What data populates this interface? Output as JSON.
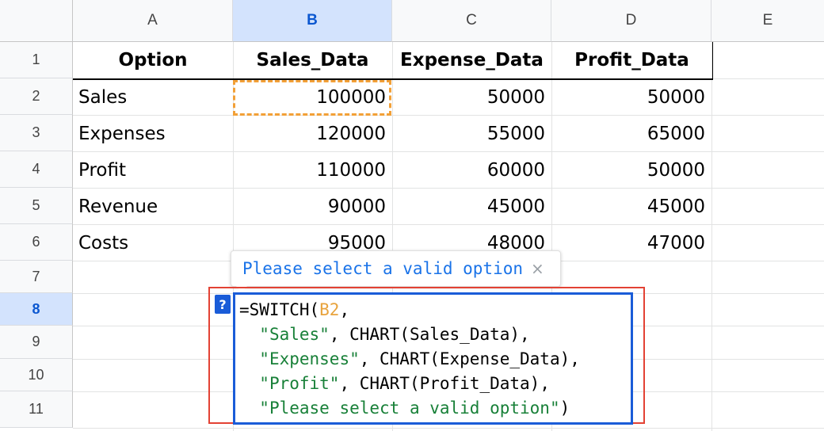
{
  "columns": [
    "A",
    "B",
    "C",
    "D",
    "E"
  ],
  "selected_column": "B",
  "rows": [
    "1",
    "2",
    "3",
    "4",
    "5",
    "6",
    "7",
    "8",
    "9",
    "10",
    "11"
  ],
  "selected_row": "8",
  "table": {
    "headers": [
      "Option",
      "Sales_Data",
      "Expense_Data",
      "Profit_Data"
    ],
    "data": [
      [
        "Sales",
        "100000",
        "50000",
        "50000"
      ],
      [
        "Expenses",
        "120000",
        "55000",
        "65000"
      ],
      [
        "Profit",
        "110000",
        "60000",
        "50000"
      ],
      [
        "Revenue",
        "90000",
        "45000",
        "45000"
      ],
      [
        "Costs",
        "95000",
        "48000",
        "47000"
      ]
    ]
  },
  "tooltip": {
    "text": "Please select a valid option",
    "close_glyph": "×"
  },
  "formula_help_glyph": "?",
  "formula": {
    "l1_prefix": "=SWITCH(",
    "l1_ref": "B2",
    "l1_suffix": ",",
    "l2_str": "\"Sales\"",
    "l2_rest": ", CHART(Sales_Data),",
    "l3_str": "\"Expenses\"",
    "l3_rest": ", CHART(Expense_Data),",
    "l4_str": "\"Profit\"",
    "l4_rest": ", CHART(Profit_Data),",
    "l5_str": "\"Please select a valid option\"",
    "l5_rest": ")"
  },
  "colors": {
    "selection_header": "#d3e3fd",
    "editor_border": "#1a5cd8",
    "highlight_outline": "#e34234",
    "copy_marquee": "#f2a037",
    "string_literal": "#188038",
    "cell_reference": "#e8a33d"
  }
}
